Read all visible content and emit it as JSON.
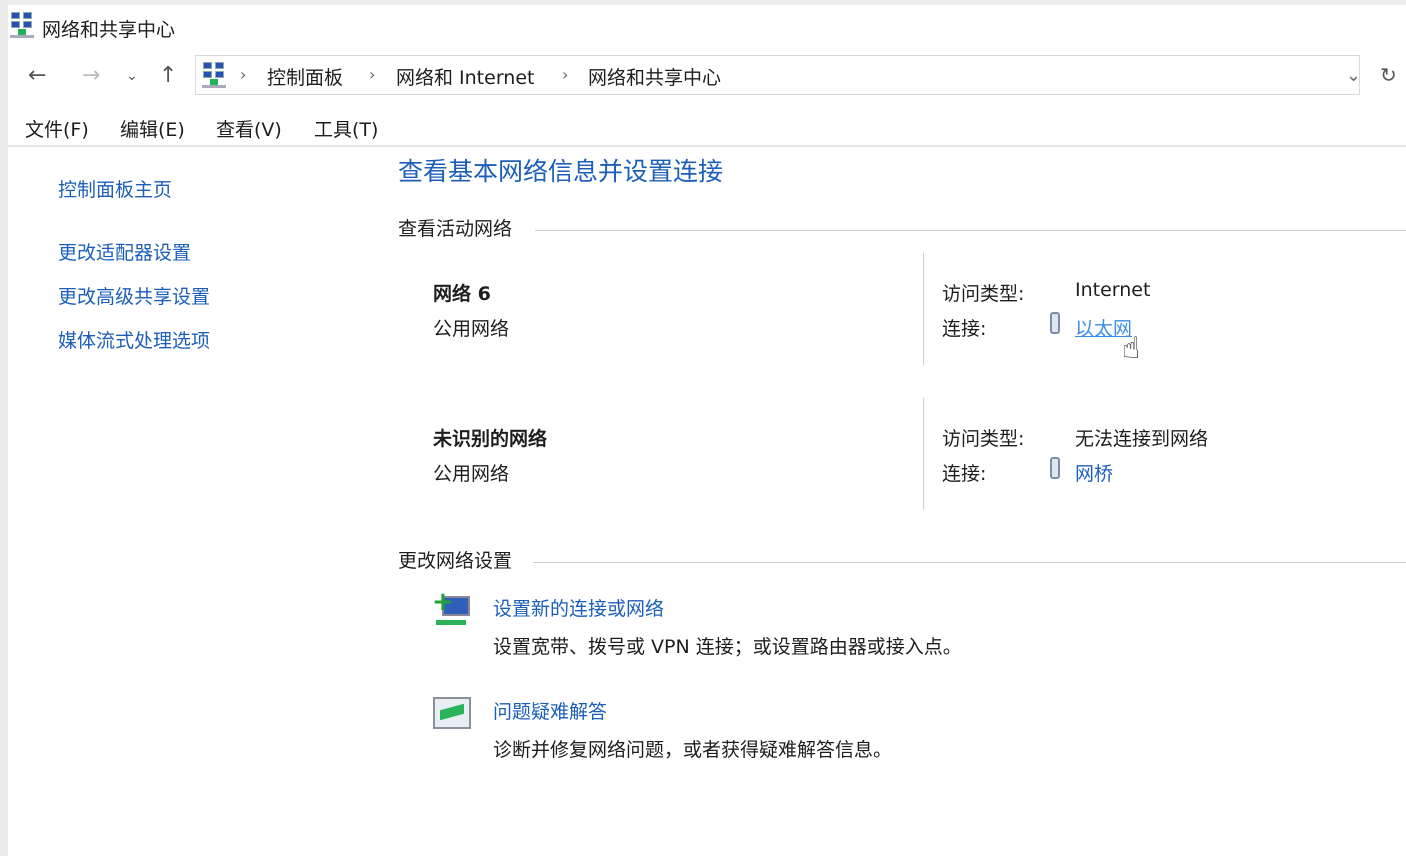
{
  "window": {
    "title": "网络和共享中心"
  },
  "address": {
    "crumbs": [
      "控制面板",
      "网络和 Internet",
      "网络和共享中心"
    ]
  },
  "menu": [
    "文件(F)",
    "编辑(E)",
    "查看(V)",
    "工具(T)"
  ],
  "sidebar": [
    "控制面板主页",
    "更改适配器设置",
    "更改高级共享设置",
    "媒体流式处理选项"
  ],
  "main": {
    "heading": "查看基本网络信息并设置连接",
    "active_section": "查看活动网络",
    "access_label": "访问类型:",
    "conn_label": "连接:",
    "networks": [
      {
        "name": "网络 6",
        "type": "公用网络",
        "access": "Internet",
        "connection": "以太网"
      },
      {
        "name": "未识别的网络",
        "type": "公用网络",
        "access": "无法连接到网络",
        "connection": "网桥"
      }
    ],
    "change_section": "更改网络设置",
    "tasks": [
      {
        "title": "设置新的连接或网络",
        "desc": "设置宽带、拨号或 VPN 连接；或设置路由器或接入点。"
      },
      {
        "title": "问题疑难解答",
        "desc": "诊断并修复网络问题，或者获得疑难解答信息。"
      }
    ]
  }
}
